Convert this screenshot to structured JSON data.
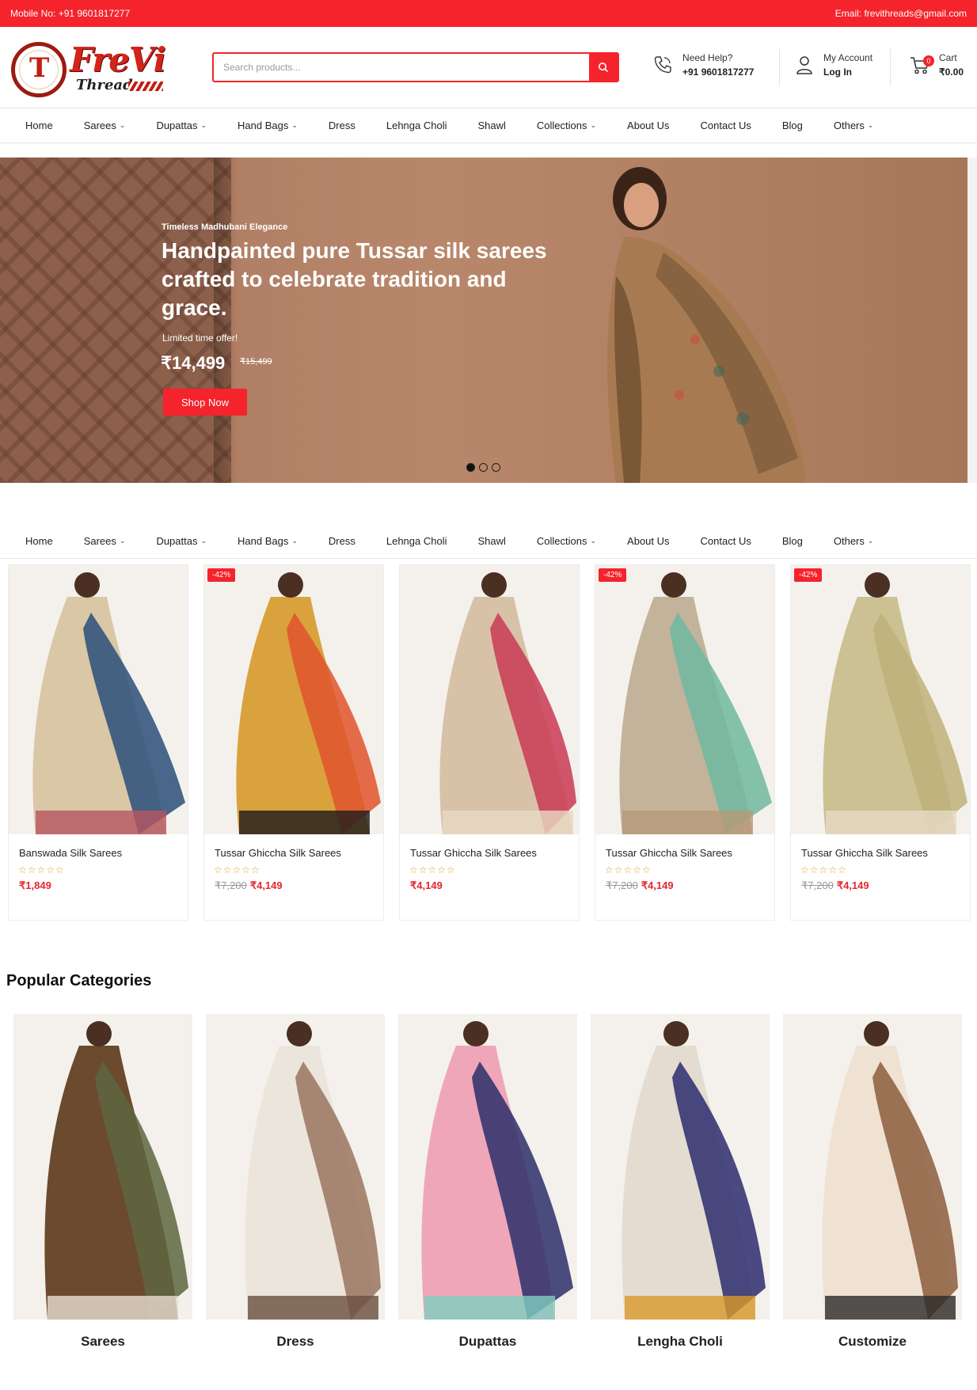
{
  "topbar": {
    "mobile": "Mobile No: +91 9601817277",
    "email": "Email: frevithreads@gmail.com"
  },
  "logo": {
    "brand": "FreVi",
    "sub": "Threads"
  },
  "search": {
    "placeholder": "Search products..."
  },
  "help": {
    "label": "Need Help?",
    "phone": "+91 9601817277"
  },
  "account": {
    "label": "My Account",
    "action": "Log In"
  },
  "cart": {
    "label": "Cart",
    "total": "₹0.00",
    "count": "0"
  },
  "nav": [
    {
      "label": "Home",
      "dropdown": false
    },
    {
      "label": "Sarees",
      "dropdown": true
    },
    {
      "label": "Dupattas",
      "dropdown": true
    },
    {
      "label": "Hand Bags",
      "dropdown": true
    },
    {
      "label": "Dress",
      "dropdown": false
    },
    {
      "label": "Lehnga Choli",
      "dropdown": false
    },
    {
      "label": "Shawl",
      "dropdown": false
    },
    {
      "label": "Collections",
      "dropdown": true
    },
    {
      "label": "About Us",
      "dropdown": false
    },
    {
      "label": "Contact Us",
      "dropdown": false
    },
    {
      "label": "Blog",
      "dropdown": false
    },
    {
      "label": "Others",
      "dropdown": true
    }
  ],
  "hero": {
    "eyebrow": "Timeless Madhubani Elegance",
    "headline": "Handpainted pure Tussar silk sarees crafted to celebrate tradition and grace.",
    "offer": "Limited time offer!",
    "price": "₹14,499",
    "old_price": "₹15,499",
    "cta": "Shop Now",
    "slides": 3,
    "active_slide": 1
  },
  "products": [
    {
      "name": "Banswada Silk Sarees",
      "badge": "",
      "old_price": "",
      "price": "₹1,849",
      "rating": "☆☆☆☆☆",
      "colors": [
        "#d9c7a6",
        "#2a4f7a",
        "#b65560"
      ]
    },
    {
      "name": "Tussar Ghiccha Silk Sarees",
      "badge": "-42%",
      "old_price": "₹7,200",
      "price": "₹4,149",
      "rating": "☆☆☆☆☆",
      "colors": [
        "#d9a23d",
        "#e0542b",
        "#1b1b1b"
      ]
    },
    {
      "name": "Tussar Ghiccha Silk Sarees",
      "badge": "",
      "old_price": "",
      "price": "₹4,149",
      "rating": "☆☆☆☆☆",
      "colors": [
        "#d7c2a8",
        "#c93a55",
        "#e8d9c4"
      ]
    },
    {
      "name": "Tussar Ghiccha Silk Sarees",
      "badge": "-42%",
      "old_price": "₹7,200",
      "price": "₹4,149",
      "rating": "☆☆☆☆☆",
      "colors": [
        "#c3b39a",
        "#6fb9a0",
        "#b79a78"
      ]
    },
    {
      "name": "Tussar Ghiccha Silk Sarees",
      "badge": "-42%",
      "old_price": "₹7,200",
      "price": "₹4,149",
      "rating": "☆☆☆☆☆",
      "colors": [
        "#cbc193",
        "#bfb07a",
        "#e6dbc5"
      ]
    }
  ],
  "popular": {
    "title": "Popular Categories",
    "items": [
      {
        "label": "Sarees",
        "colors": [
          "#6b4a2e",
          "#5d6640",
          "#e9dfd0"
        ]
      },
      {
        "label": "Dress",
        "colors": [
          "#ece5dc",
          "#9a7560",
          "#6b4f3e"
        ]
      },
      {
        "label": "Dupattas",
        "colors": [
          "#f0a6b9",
          "#2b2f6a",
          "#7fd0c0"
        ]
      },
      {
        "label": "Lengha Choli",
        "colors": [
          "#e4dcd0",
          "#2b2c6e",
          "#d99a2a"
        ]
      },
      {
        "label": "Customize",
        "colors": [
          "#f0e2d2",
          "#8b5d3c",
          "#2a2a2a"
        ]
      }
    ]
  }
}
